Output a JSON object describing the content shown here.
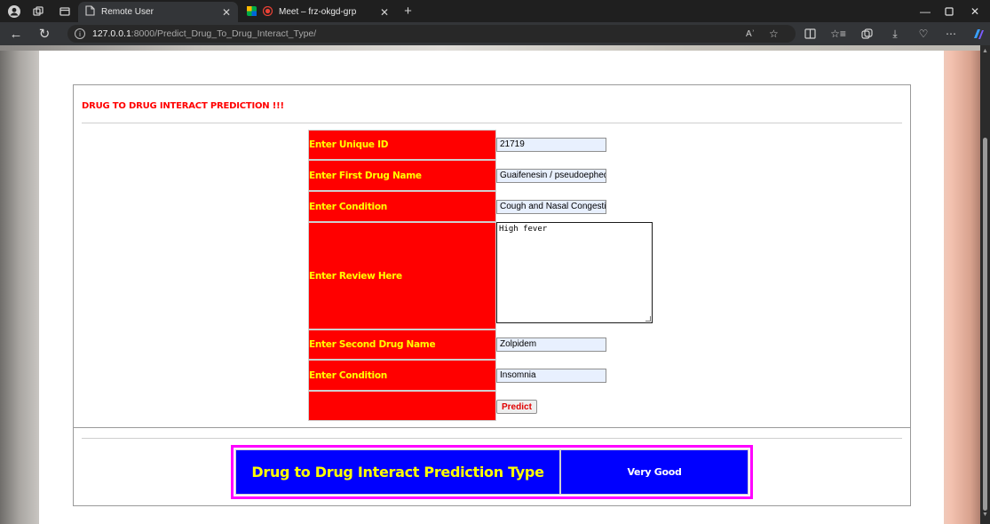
{
  "browser": {
    "tabs": [
      {
        "title": "Remote User",
        "active": true
      },
      {
        "title": "Meet – frz-okgd-grp",
        "active": false
      }
    ],
    "url_host": "127.0.0.1",
    "url_rest": ":8000/Predict_Drug_To_Drug_Interact_Type/",
    "read_aloud_label": "Aʾ"
  },
  "page": {
    "heading": "DRUG TO DRUG INTERACT PREDICTION !!!",
    "form": {
      "unique_id_label": "Enter Unique ID",
      "unique_id_value": "21719",
      "first_drug_label": "Enter First Drug Name",
      "first_drug_value": "Guaifenesin / pseudoephed",
      "condition1_label": "Enter Condition",
      "condition1_value": "Cough and Nasal Congestio",
      "review_label": "Enter Review Here",
      "review_value": "High fever",
      "second_drug_label": "Enter Second Drug Name",
      "second_drug_value": "Zolpidem",
      "condition2_label": "Enter Condition",
      "condition2_value": "Insomnia",
      "predict_label": "Predict"
    },
    "result": {
      "label": "Drug to Drug Interact Prediction Type",
      "value": "Very Good"
    }
  },
  "colors": {
    "label_bg": "#ff0000",
    "label_text": "#ffff00",
    "result_bg": "#0000ff",
    "result_border": "#ff00ff"
  }
}
